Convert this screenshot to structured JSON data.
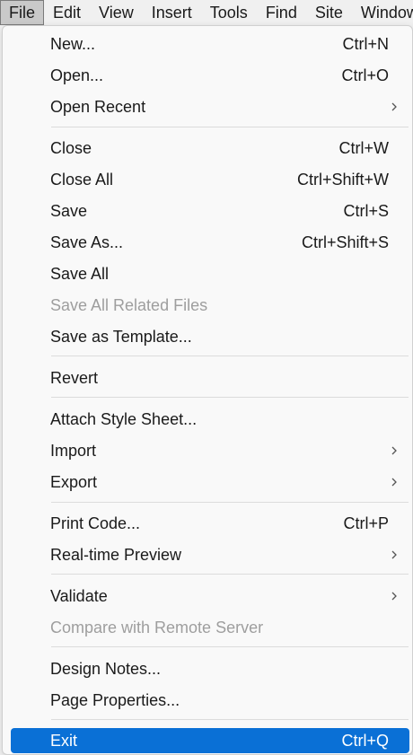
{
  "menubar": {
    "items": [
      "File",
      "Edit",
      "View",
      "Insert",
      "Tools",
      "Find",
      "Site",
      "Window"
    ]
  },
  "file_menu": {
    "items": [
      {
        "label": "New...",
        "shortcut": "Ctrl+N"
      },
      {
        "label": "Open...",
        "shortcut": "Ctrl+O"
      },
      {
        "label": "Open Recent",
        "submenu": true
      },
      {
        "label": "Close",
        "shortcut": "Ctrl+W"
      },
      {
        "label": "Close All",
        "shortcut": "Ctrl+Shift+W"
      },
      {
        "label": "Save",
        "shortcut": "Ctrl+S"
      },
      {
        "label": "Save As...",
        "shortcut": "Ctrl+Shift+S"
      },
      {
        "label": "Save All"
      },
      {
        "label": "Save All Related Files",
        "disabled": true
      },
      {
        "label": "Save as Template..."
      },
      {
        "label": "Revert"
      },
      {
        "label": "Attach Style Sheet..."
      },
      {
        "label": "Import",
        "submenu": true
      },
      {
        "label": "Export",
        "submenu": true
      },
      {
        "label": "Print Code...",
        "shortcut": "Ctrl+P"
      },
      {
        "label": "Real-time Preview",
        "submenu": true
      },
      {
        "label": "Validate",
        "submenu": true
      },
      {
        "label": "Compare with Remote Server",
        "disabled": true
      },
      {
        "label": "Design Notes..."
      },
      {
        "label": "Page Properties..."
      },
      {
        "label": "Exit",
        "shortcut": "Ctrl+Q",
        "selected": true
      }
    ]
  },
  "colors": {
    "highlight": "#0a70d6",
    "disabled_text": "#9e9e9e",
    "menu_background": "#f9f9f9"
  }
}
